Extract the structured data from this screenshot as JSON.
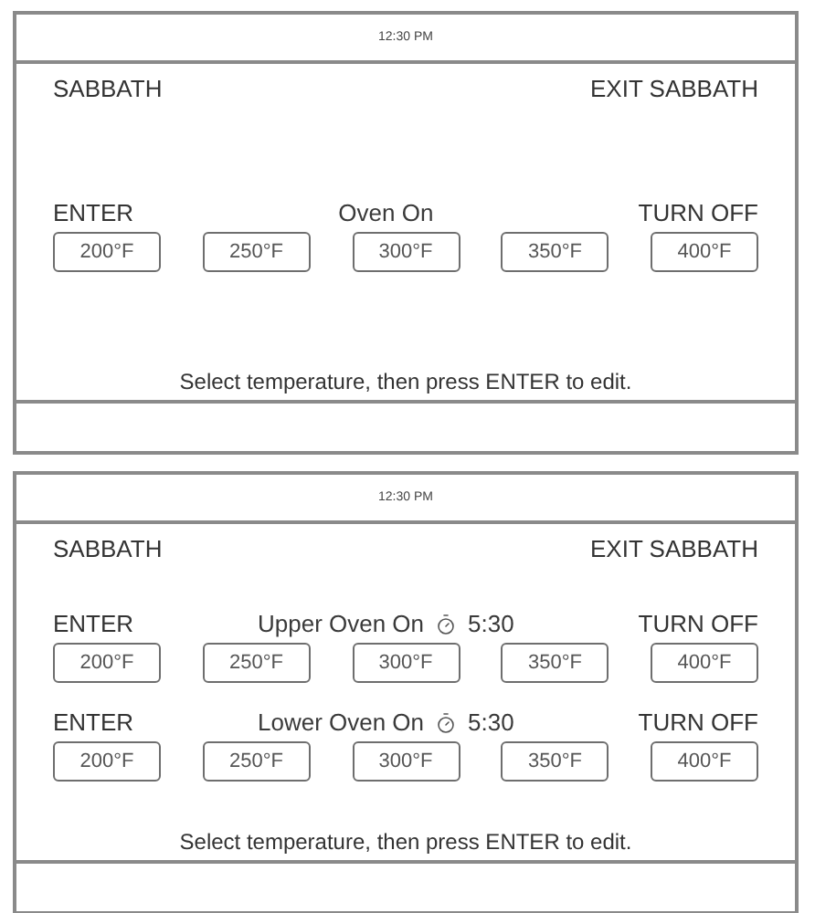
{
  "screens": [
    {
      "status_bar": {
        "time": "12:30 PM"
      },
      "header": {
        "title": "SABBATH",
        "exit": "EXIT SABBATH"
      },
      "ovens": [
        {
          "enter": "ENTER",
          "status": "Oven On",
          "turn_off": "TURN OFF",
          "temperatures": [
            "200°F",
            "250°F",
            "300°F",
            "350°F",
            "400°F"
          ]
        }
      ],
      "instruction": "Select temperature, then press ENTER to edit."
    },
    {
      "status_bar": {
        "time": "12:30 PM"
      },
      "header": {
        "title": "SABBATH",
        "exit": "EXIT SABBATH"
      },
      "ovens": [
        {
          "enter": "ENTER",
          "status": "Upper Oven On",
          "timer": "5:30",
          "turn_off": "TURN OFF",
          "temperatures": [
            "200°F",
            "250°F",
            "300°F",
            "350°F",
            "400°F"
          ]
        },
        {
          "enter": "ENTER",
          "status": "Lower Oven On",
          "timer": "5:30",
          "turn_off": "TURN OFF",
          "temperatures": [
            "200°F",
            "250°F",
            "300°F",
            "350°F",
            "400°F"
          ]
        }
      ],
      "instruction": "Select temperature, then press ENTER to edit."
    }
  ]
}
